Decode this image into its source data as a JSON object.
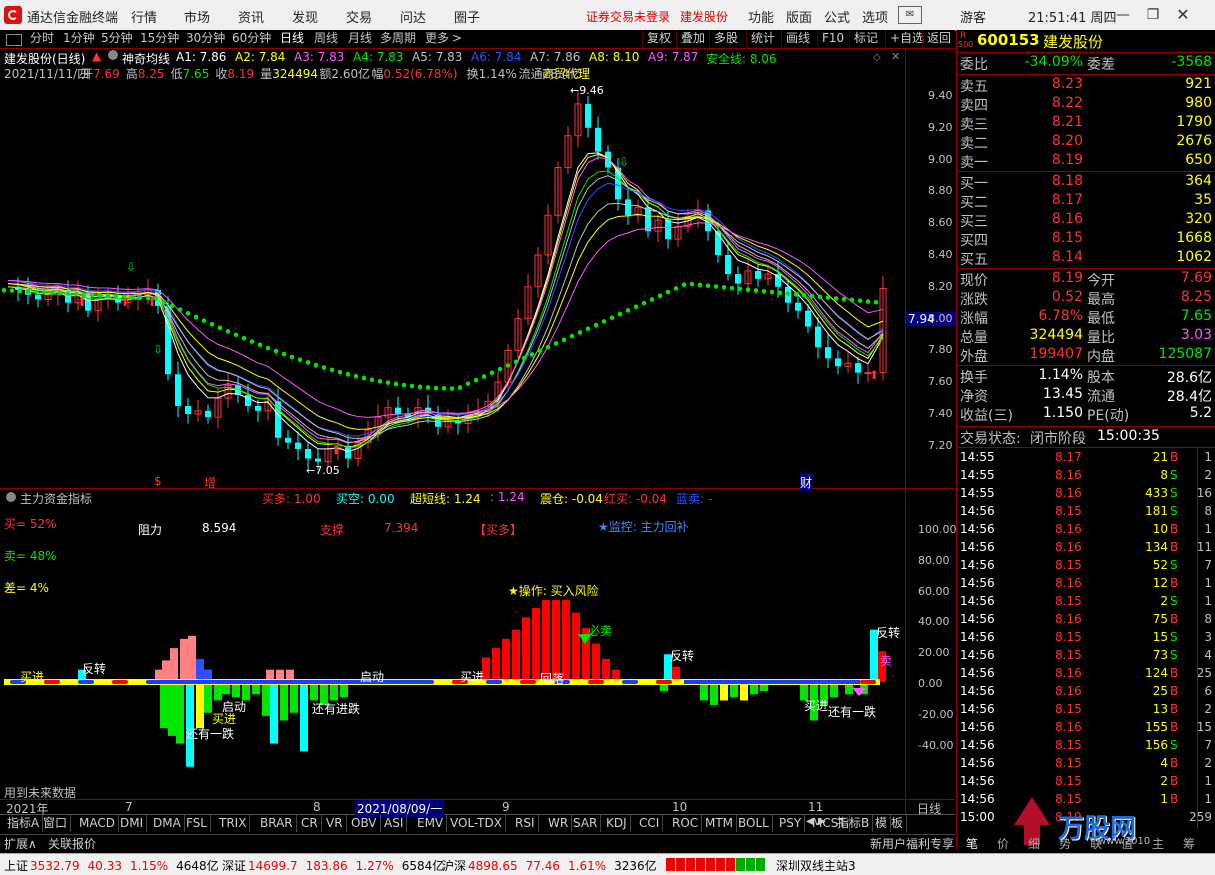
{
  "app": {
    "title": "通达信金融终端",
    "menu": [
      "行情",
      "市场",
      "资讯",
      "发现",
      "交易",
      "问达",
      "圈子"
    ],
    "notice": "证券交易未登录",
    "stock_short": "建发股份",
    "menu_right": [
      "功能",
      "版面",
      "公式",
      "选项"
    ],
    "user": "游客",
    "clock": "21:51:41 周四"
  },
  "toolbar": {
    "periods": [
      "分时",
      "1分钟",
      "5分钟",
      "15分钟",
      "30分钟",
      "60分钟",
      "日线",
      "周线",
      "月线",
      "多周期",
      "更多"
    ],
    "active_period": "日线",
    "more_arrow": ">",
    "right_buttons": [
      "复权",
      "叠加",
      "多股",
      "统计",
      "画线",
      "F10",
      "标记",
      "+自选",
      "返回"
    ]
  },
  "main_chart": {
    "title": "建发股份(日线)",
    "indicator_name": "神奇均线",
    "ma_labels": [
      {
        "text": "A1: 7.86",
        "color": "#ffffff"
      },
      {
        "text": "A2: 7.84",
        "color": "#ffff00"
      },
      {
        "text": "A3: 7.83",
        "color": "#ff55ff"
      },
      {
        "text": "A4: 7.83",
        "color": "#00e600"
      },
      {
        "text": "A5: 7.83",
        "color": "#c0c0c0"
      },
      {
        "text": "A6: 7.84",
        "color": "#3050ff"
      },
      {
        "text": "A7: 7.86",
        "color": "#c0c0c0"
      },
      {
        "text": "A8: 8.10",
        "color": "#ffff00"
      },
      {
        "text": "A9: 7.87",
        "color": "#ff55ff"
      },
      {
        "text": "安全线: 8.06",
        "color": "#00e600"
      }
    ],
    "date": "2021/11/11/四",
    "info": [
      {
        "label": "开",
        "value": "7.69"
      },
      {
        "label": "高",
        "value": "8.25"
      },
      {
        "label": "低",
        "value": "7.65"
      },
      {
        "label": "收",
        "value": "8.19"
      },
      {
        "label": "量",
        "value": "324494"
      },
      {
        "label": "额",
        "value": "2.60亿"
      },
      {
        "label": "幅",
        "value": "0.52(6.78%)"
      },
      {
        "label": "换",
        "value": "1.14%"
      },
      {
        "label": "流通",
        "value": "28.4亿"
      }
    ],
    "industry": "商贸代理",
    "price_axis": [
      "9.40",
      "9.20",
      "9.00",
      "8.80",
      "8.60",
      "8.40",
      "8.20",
      "8.00",
      "7.80",
      "7.60",
      "7.40",
      "7.20"
    ],
    "current_price_tag": "7.94",
    "high_label": "9.46",
    "low_label": "7.05",
    "event_labels": [
      "$",
      "增",
      "财"
    ]
  },
  "sub_chart": {
    "title": "主力资金指标",
    "header": [
      {
        "text": "买多: 1.00",
        "color": "#ff3232"
      },
      {
        "text": "买空: 0.00",
        "color": "#00ffff"
      },
      {
        "text": "超短线: 1.24",
        "color": "#ffff00"
      },
      {
        "text": ": 1.24",
        "color": "#ff55ff"
      },
      {
        "text": "震仓: -0.04",
        "color": "#ffff00"
      },
      {
        "text": "红买: -0.04",
        "color": "#ff3232"
      },
      {
        "text": "蓝卖: -",
        "color": "#3050ff"
      }
    ],
    "buy_pct": "买= 52%",
    "sell_pct": "卖= 48%",
    "diff_pct": "差= 4%",
    "resistance_label": "阻力",
    "resistance_value": "8.594",
    "support_label": "支撑",
    "support_value": "7.394",
    "signal": "【买多】",
    "monitor": "★监控: 主力回补",
    "operation": "★操作: 买入风险",
    "annotations": [
      "买进",
      "反转",
      "启动",
      "买进",
      "还有一跌",
      "还有进跌",
      "启动",
      "买进",
      "回落",
      "必卖",
      "反转",
      "买进",
      "还有一跌",
      "反转",
      "卖"
    ],
    "axis": [
      "100.00",
      "80.00",
      "60.00",
      "40.00",
      "20.00",
      "0.00",
      "-20.00",
      "-40.00"
    ],
    "footnote": "用到未来数据"
  },
  "time_axis": {
    "labels": [
      "2021年",
      "7",
      "8",
      "2021/08/09/一",
      "9",
      "10",
      "11"
    ],
    "period": "日线"
  },
  "bottom_tabs": [
    "指标A",
    "窗口",
    "MACD",
    "DMI",
    "DMA",
    "FSL",
    "TRIX",
    "BRAR",
    "CR",
    "VR",
    "OBV",
    "ASI",
    "EMV",
    "VOL-TDX",
    "RSI",
    "WR",
    "SAR",
    "KDJ",
    "CCI",
    "ROC",
    "MTM",
    "BOLL",
    "PSY",
    "MCST"
  ],
  "bottom_tabs_right": [
    "指标B",
    "模",
    "板"
  ],
  "bottom_row2": [
    "扩展∧",
    "关联报价"
  ],
  "bottom_row2_right": "新用户福利专享",
  "quote": {
    "code": "600153",
    "name": "建发股份",
    "r_label": "R",
    "index_label": "500",
    "weibi_label": "委比",
    "weibi": "-34.09%",
    "weicha_label": "委差",
    "weicha": "-3568",
    "asks": [
      {
        "label": "卖五",
        "price": "8.23",
        "vol": "921"
      },
      {
        "label": "卖四",
        "price": "8.22",
        "vol": "980"
      },
      {
        "label": "卖三",
        "price": "8.21",
        "vol": "1790"
      },
      {
        "label": "卖二",
        "price": "8.20",
        "vol": "2676"
      },
      {
        "label": "卖一",
        "price": "8.19",
        "vol": "650"
      }
    ],
    "bids": [
      {
        "label": "买一",
        "price": "8.18",
        "vol": "364"
      },
      {
        "label": "买二",
        "price": "8.17",
        "vol": "35"
      },
      {
        "label": "买三",
        "price": "8.16",
        "vol": "320"
      },
      {
        "label": "买四",
        "price": "8.15",
        "vol": "1668"
      },
      {
        "label": "买五",
        "price": "8.14",
        "vol": "1062"
      }
    ],
    "stats": [
      {
        "l1": "现价",
        "v1": "8.19",
        "c1": "#ff3232",
        "l2": "今开",
        "v2": "7.69",
        "c2": "#ff3232"
      },
      {
        "l1": "涨跌",
        "v1": "0.52",
        "c1": "#ff3232",
        "l2": "最高",
        "v2": "8.25",
        "c2": "#ff3232"
      },
      {
        "l1": "涨幅",
        "v1": "6.78%",
        "c1": "#ff3232",
        "l2": "最低",
        "v2": "7.65",
        "c2": "#00e600"
      },
      {
        "l1": "总量",
        "v1": "324494",
        "c1": "#ffff00",
        "l2": "量比",
        "v2": "3.03",
        "c2": "#ff55ff"
      },
      {
        "l1": "外盘",
        "v1": "199407",
        "c1": "#ff3232",
        "l2": "内盘",
        "v2": "125087",
        "c2": "#00e600"
      }
    ],
    "stats2": [
      {
        "l1": "换手",
        "v1": "1.14%",
        "l2": "股本",
        "v2": "28.6亿"
      },
      {
        "l1": "净资",
        "v1": "13.45",
        "l2": "流通",
        "v2": "28.4亿"
      },
      {
        "l1": "收益(三)",
        "v1": "1.150",
        "l2": "PE(动)",
        "v2": "5.2"
      }
    ],
    "trade_status_label": "交易状态:",
    "trade_status": "闭市阶段",
    "trade_time": "15:00:35",
    "ticks": [
      {
        "t": "14:55",
        "p": "8.17",
        "v": "21",
        "s": "B",
        "n": "1"
      },
      {
        "t": "14:55",
        "p": "8.16",
        "v": "8",
        "s": "S",
        "n": "2"
      },
      {
        "t": "14:55",
        "p": "8.16",
        "v": "433",
        "s": "S",
        "n": "16"
      },
      {
        "t": "14:56",
        "p": "8.15",
        "v": "181",
        "s": "S",
        "n": "8"
      },
      {
        "t": "14:56",
        "p": "8.16",
        "v": "10",
        "s": "B",
        "n": "1"
      },
      {
        "t": "14:56",
        "p": "8.16",
        "v": "134",
        "s": "B",
        "n": "11"
      },
      {
        "t": "14:56",
        "p": "8.15",
        "v": "52",
        "s": "S",
        "n": "7"
      },
      {
        "t": "14:56",
        "p": "8.16",
        "v": "12",
        "s": "B",
        "n": "1"
      },
      {
        "t": "14:56",
        "p": "8.15",
        "v": "2",
        "s": "S",
        "n": "1"
      },
      {
        "t": "14:56",
        "p": "8.16",
        "v": "75",
        "s": "B",
        "n": "8"
      },
      {
        "t": "14:56",
        "p": "8.15",
        "v": "15",
        "s": "S",
        "n": "3"
      },
      {
        "t": "14:56",
        "p": "8.15",
        "v": "73",
        "s": "S",
        "n": "4"
      },
      {
        "t": "14:56",
        "p": "8.16",
        "v": "124",
        "s": "B",
        "n": "25"
      },
      {
        "t": "14:56",
        "p": "8.16",
        "v": "25",
        "s": "B",
        "n": "6"
      },
      {
        "t": "14:56",
        "p": "8.15",
        "v": "13",
        "s": "B",
        "n": "2"
      },
      {
        "t": "14:56",
        "p": "8.16",
        "v": "155",
        "s": "B",
        "n": "15"
      },
      {
        "t": "14:56",
        "p": "8.15",
        "v": "156",
        "s": "S",
        "n": "7"
      },
      {
        "t": "14:56",
        "p": "8.15",
        "v": "4",
        "s": "B",
        "n": "2"
      },
      {
        "t": "14:56",
        "p": "8.15",
        "v": "2",
        "s": "B",
        "n": "1"
      },
      {
        "t": "14:56",
        "p": "8.15",
        "v": "1",
        "s": "B",
        "n": "1"
      },
      {
        "t": "15:00",
        "p": "8.19",
        "v": "",
        "s": "",
        "n": "259"
      }
    ],
    "panel_tabs": [
      "笔",
      "价",
      "细",
      "势",
      "联",
      "值",
      "主",
      "筹"
    ]
  },
  "statusbar": {
    "items": [
      {
        "name": "上证",
        "price": "3532.79",
        "chg": "40.33",
        "pct": "1.15%",
        "amt": "4648亿"
      },
      {
        "name": "深证",
        "price": "14699.7",
        "chg": "183.86",
        "pct": "1.27%",
        "amt": "6584亿"
      },
      {
        "name": "沪深",
        "price": "4898.65",
        "chg": "77.46",
        "pct": "1.61%",
        "amt": "3236亿"
      }
    ],
    "server": "深圳双线主站3",
    "watermark": "万股网",
    "watermark_url": "www.2010"
  },
  "colors": {
    "up": "#ff3232",
    "down": "#00e600",
    "bg": "#000000",
    "grid": "#8b0000",
    "cyan": "#00ffff",
    "yellow": "#ffff00"
  }
}
